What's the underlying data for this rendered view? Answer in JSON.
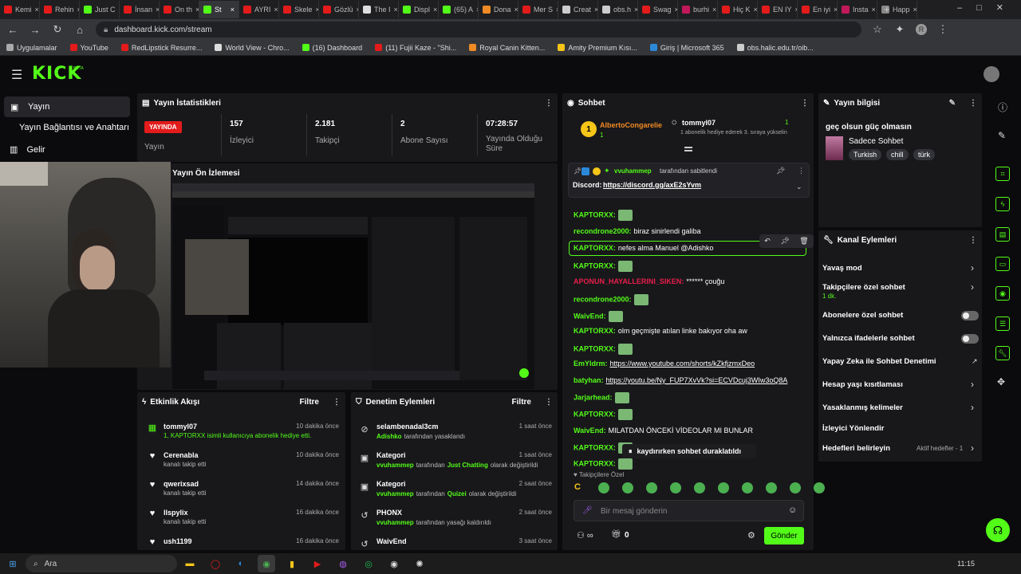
{
  "browser": {
    "tabs": [
      {
        "label": "Kemi",
        "color": "#e31b1b"
      },
      {
        "label": "Rehin",
        "color": "#e31b1b"
      },
      {
        "label": "Just C",
        "color": "#53fc18"
      },
      {
        "label": "İnsan",
        "color": "#e31b1b"
      },
      {
        "label": "On th",
        "color": "#e31b1b"
      },
      {
        "label": "St",
        "color": "#53fc18"
      },
      {
        "label": "AYRI",
        "color": "#e31b1b"
      },
      {
        "label": "Skele",
        "color": "#e31b1b"
      },
      {
        "label": "Gözlü",
        "color": "#e31b1b"
      },
      {
        "label": "The I",
        "color": "#dddddd"
      },
      {
        "label": "Displ",
        "color": "#53fc18"
      },
      {
        "label": "(65) A",
        "color": "#53fc18"
      },
      {
        "label": "Dona",
        "color": "#f08a24"
      },
      {
        "label": "Mer S",
        "color": "#e31b1b"
      },
      {
        "label": "Creat",
        "color": "#cccccc"
      },
      {
        "label": "obs.h",
        "color": "#cccccc"
      },
      {
        "label": "Swag",
        "color": "#e31b1b"
      },
      {
        "label": "burhi",
        "color": "#c2185b"
      },
      {
        "label": "Hiç K",
        "color": "#e31b1b"
      },
      {
        "label": "EN IY",
        "color": "#e31b1b"
      },
      {
        "label": "En iyi",
        "color": "#e31b1b"
      },
      {
        "label": "Insta",
        "color": "#c2185b"
      },
      {
        "label": "Happ",
        "color": "#888888"
      }
    ],
    "url": "dashboard.kick.com/stream",
    "bookmarks": [
      {
        "label": "Uygulamalar",
        "color": "#aaaaaa"
      },
      {
        "label": "YouTube",
        "color": "#e31b1b"
      },
      {
        "label": "RedLipstick Resurre...",
        "color": "#e31b1b"
      },
      {
        "label": "World View - Chro...",
        "color": "#dddddd"
      },
      {
        "label": "(16) Dashboard",
        "color": "#53fc18"
      },
      {
        "label": "(11) Fujii Kaze - \"Shi...",
        "color": "#e31b1b"
      },
      {
        "label": "Royal Canin Kitten...",
        "color": "#f08a24"
      },
      {
        "label": "Amity Premium Kısı...",
        "color": "#f5c518"
      },
      {
        "label": "Giriş | Microsoft 365",
        "color": "#2b88d8"
      },
      {
        "label": "obs.halic.edu.tr/oib...",
        "color": "#cccccc"
      }
    ]
  },
  "kick": {
    "logo": "KICK",
    "beta": "BETA",
    "sidebar": [
      "Yayın",
      "Yayın Bağlantısı ve Anahtarı",
      "Gelir"
    ]
  },
  "stats": {
    "title": "Yayın İstatistikleri",
    "live_badge": "YAYINDA",
    "live_label": "Yayın",
    "items": [
      {
        "value": "157",
        "label": "İzleyici"
      },
      {
        "value": "2.181",
        "label": "Takipçi"
      },
      {
        "value": "2",
        "label": "Abone Sayısı"
      },
      {
        "value": "07:28:57",
        "label": "Yayında Olduğu Süre"
      }
    ]
  },
  "preview": {
    "title": "Yayın Ön İzlemesi"
  },
  "activity": {
    "title": "Etkinlik Akışı",
    "filter": "Filtre",
    "items": [
      {
        "name": "tommyl07",
        "sub": "1, KAPTORXX isimli kullanıcıya abonelik hediye etti.",
        "time": "10 dakika önce"
      },
      {
        "name": "Cerenabla",
        "sub": "kanalı takip etti",
        "time": "10 dakika önce"
      },
      {
        "name": "qwerixsad",
        "sub": "kanalı takip etti",
        "time": "14 dakika önce"
      },
      {
        "name": "llspylix",
        "sub": "kanalı takip etti",
        "time": "16 dakika önce"
      },
      {
        "name": "ush1199",
        "sub": "",
        "time": "16 dakika önce"
      }
    ]
  },
  "moderation": {
    "title": "Denetim Eylemleri",
    "filter": "Filtre",
    "items": [
      {
        "name": "selambenadal3cm",
        "user": "Adishko",
        "action": "tarafından yasaklandı",
        "extra": "",
        "time": "1 saat önce"
      },
      {
        "name": "Kategori",
        "user": "vvuhammep",
        "action": "tarafından",
        "extra": "Just Chatting",
        "tail": "olarak değiştirildi",
        "time": "1 saat önce"
      },
      {
        "name": "Kategori",
        "user": "vvuhammep",
        "action": "tarafından",
        "extra": "Quizei",
        "tail": "olarak değiştirildi",
        "time": "2 saat önce"
      },
      {
        "name": "PHONX",
        "user": "vvuhammep",
        "action": "tarafından yasağı kaldırıldı",
        "extra": "",
        "time": "2 saat önce"
      },
      {
        "name": "WaivEnd",
        "user": "",
        "action": "",
        "extra": "",
        "time": "3 saat önce"
      }
    ]
  },
  "chat": {
    "title": "Sohbet",
    "gifter": "AlbertoCongarelie",
    "gifter_count": "1",
    "gift_user": "tommyl07",
    "gift_text": "1 abonelik hediye ederek 3. sıraya yükselin",
    "gift_count": "1",
    "pinned_by": "vvuhammep",
    "pinned_suffix": "tarafından sabitlendi",
    "pinned_label": "Discord:",
    "pinned_link": "https://discord.gg/axE2sYvm",
    "messages": [
      {
        "user": "KAPTORXX:",
        "color": "#53fc18",
        "text": "",
        "emote": true
      },
      {
        "user": "recondrone2000:",
        "color": "#53fc18",
        "text": "biraz sinirlendi galiba",
        "emote": false
      },
      {
        "user": "KAPTORXX:",
        "color": "#53fc18",
        "text": "nefes alma Manuel @Adishko",
        "emote": false
      },
      {
        "user": "KAPTORXX:",
        "color": "#53fc18",
        "text": "",
        "emote": true
      },
      {
        "user": "APONUN_HAYALLERINI_SIKEN:",
        "color": "#e91e4a",
        "text": "****** çouğu",
        "emote": false
      },
      {
        "user": "recondrone2000:",
        "color": "#53fc18",
        "text": "",
        "emote": true
      },
      {
        "user": "WaivEnd:",
        "color": "#53fc18",
        "text": "",
        "emote": true
      },
      {
        "user": "KAPTORXX:",
        "color": "#53fc18",
        "text": "olm geçmişte atılan linke bakıyor oha aw",
        "emote": false
      },
      {
        "user": "KAPTORXX:",
        "color": "#53fc18",
        "text": "",
        "emote": true
      },
      {
        "user": "EmYldrm:",
        "color": "#53fc18",
        "text": "https://www.youtube.com/shorts/kZkfjzmxDeo",
        "emote": false
      },
      {
        "user": "batyhan:",
        "color": "#53fc18",
        "text": "https://youtu.be/Ny_FUP7XvVk?si=ECVDcuj3WIw3oQ8A",
        "emote": false
      },
      {
        "user": "Jarjarhead:",
        "color": "#53fc18",
        "text": "",
        "emote": true
      },
      {
        "user": "KAPTORXX:",
        "color": "#53fc18",
        "text": "",
        "emote": true
      },
      {
        "user": "WaivEnd:",
        "color": "#53fc18",
        "text": "MILATDAN ÖNCEKİ VİDEOLAR MI BUNLAR",
        "emote": false
      },
      {
        "user": "KAPTORXX:",
        "color": "#53fc18",
        "text": "",
        "emote": true
      },
      {
        "user": "KAPTORXX:",
        "color": "#53fc18",
        "text": "",
        "emote": true
      }
    ],
    "paused": "kaydırırken sohbet duraklatıldı",
    "followers_only": "Takipçilere Özel",
    "input_placeholder": "Bir mesaj gönderin",
    "points": "0",
    "send": "Gönder"
  },
  "stream_info": {
    "title": "Yayın bilgisi",
    "stream_title": "geç olsun güç olmasın",
    "category": "Sadece Sohbet",
    "tags": [
      "Turkish",
      "chill",
      "türk"
    ]
  },
  "channel_actions": {
    "title": "Kanal Eylemleri",
    "items": [
      {
        "label": "Yavaş mod",
        "sub": "",
        "control": "chevron"
      },
      {
        "label": "Takipçilere özel sohbet",
        "sub": "1 dk.",
        "control": "chevron"
      },
      {
        "label": "Abonelere özel sohbet",
        "sub": "",
        "control": "toggle"
      },
      {
        "label": "Yalnızca ifadelerle sohbet",
        "sub": "",
        "control": "toggle"
      },
      {
        "label": "Yapay Zeka ile Sohbet Denetimi",
        "sub": "",
        "control": "external"
      },
      {
        "label": "Hesap yaşı kısıtlaması",
        "sub": "",
        "control": "chevron"
      },
      {
        "label": "Yasaklanmış kelimeler",
        "sub": "",
        "control": "chevron"
      },
      {
        "label": "İzleyici Yönlendir",
        "sub": "",
        "control": "none"
      },
      {
        "label": "Hedefleri belirleyin",
        "sub": "Aktif hedefler - 1",
        "control": "chevron"
      }
    ]
  },
  "taskbar": {
    "search": "Ara",
    "time": "11:15"
  }
}
